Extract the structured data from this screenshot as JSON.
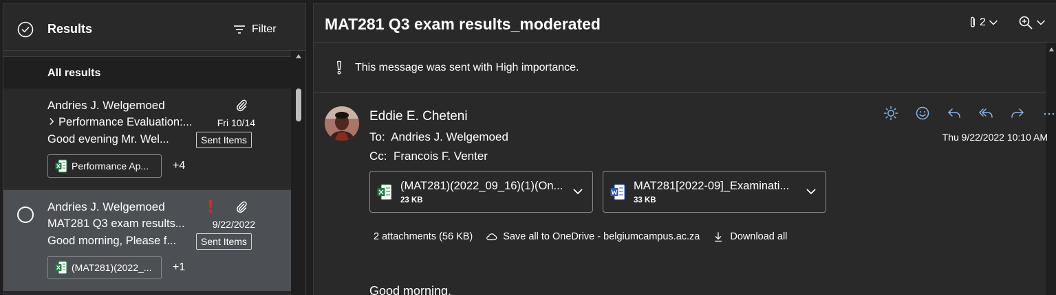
{
  "results_pane": {
    "title": "Results",
    "filter_label": "Filter",
    "section_header": "All results",
    "messages": [
      {
        "sender": "Andries J. Welgemoed",
        "subject": "Performance Evaluation:...",
        "date": "Fri 10/14",
        "preview": "Good evening Mr. Wel...",
        "folder": "Sent Items",
        "attachment_chip": "Performance Ap...",
        "more_attachments": "+4",
        "has_attachment": true,
        "high_importance": false,
        "selected": false,
        "thread_collapsed": true
      },
      {
        "sender": "Andries J. Welgemoed",
        "subject": "MAT281 Q3 exam results...",
        "date": "9/22/2022",
        "preview": "Good morning, Please f...",
        "folder": "Sent Items",
        "attachment_chip": "(MAT281)(2022_...",
        "more_attachments": "+1",
        "has_attachment": true,
        "high_importance": true,
        "selected": true,
        "thread_collapsed": false
      }
    ]
  },
  "reading_pane": {
    "subject": "MAT281 Q3 exam results_moderated",
    "attachment_count": "2",
    "importance_notice": "This message was sent with High importance.",
    "from": "Eddie E. Cheteni",
    "to_label": "To:",
    "to": "Andries J. Welgemoed",
    "cc_label": "Cc:",
    "cc": "Francois F. Venter",
    "received": "Thu 9/22/2022 10:10 AM",
    "attachments": [
      {
        "name": "(MAT281)(2022_09_16)(1)(On...",
        "size": "23 KB",
        "type": "excel"
      },
      {
        "name": "MAT281[2022-09]_Examinati...",
        "size": "33 KB",
        "type": "word"
      }
    ],
    "attachments_summary": "2 attachments (56 KB)",
    "save_to_onedrive": "Save all to OneDrive - belgiumcampus.ac.za",
    "download_all": "Download all",
    "body_start": "Good morning,"
  },
  "colors": {
    "pane_background": "#292929",
    "selected_row": "#4c5054",
    "accent_blue": "#8ab4e8",
    "importance_red": "#e02525",
    "excel_green": "#1d7a45",
    "word_blue": "#2b5fb4"
  },
  "icons": {
    "results_check": "check-circle-icon",
    "filter": "filter-icon",
    "attachment": "paperclip-icon",
    "importance": "exclamation-icon",
    "zoom": "zoom-in-icon",
    "actions": [
      "sun-icon",
      "emoji-icon",
      "reply-icon",
      "reply-all-icon",
      "forward-icon",
      "more-icon"
    ]
  }
}
